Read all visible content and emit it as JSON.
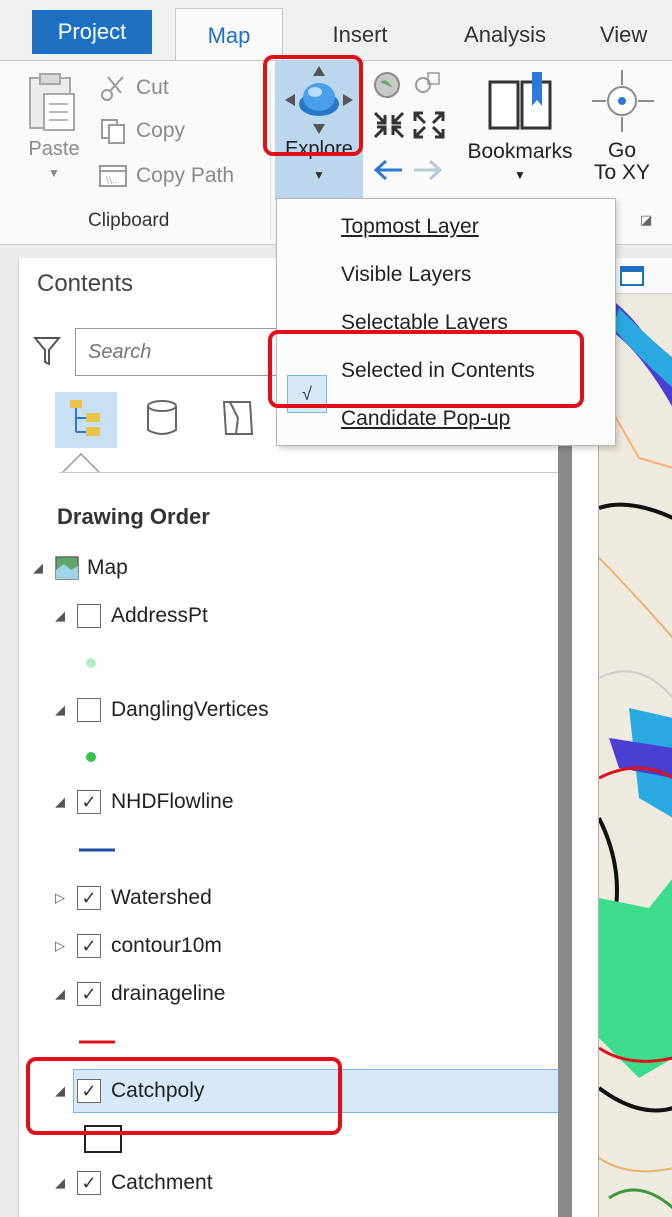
{
  "tabs": [
    {
      "label": "Project"
    },
    {
      "label": "Map"
    },
    {
      "label": "Insert"
    },
    {
      "label": "Analysis"
    },
    {
      "label": "View"
    }
  ],
  "clipboard": {
    "paste": "Paste",
    "cut": "Cut",
    "copy": "Copy",
    "copy_path": "Copy Path",
    "group_label": "Clipboard"
  },
  "navigate": {
    "explore": "Explore",
    "bookmarks": "Bookmarks",
    "goto_line1": "Go",
    "goto_line2": "To XY"
  },
  "explore_menu": {
    "items": [
      {
        "label": "Topmost Layer"
      },
      {
        "label": "Visible Layers"
      },
      {
        "label": "Selectable Layers"
      },
      {
        "label": "Selected in Contents"
      },
      {
        "label": "Candidate Pop-up"
      }
    ],
    "checked": "Selected in Contents",
    "check_glyph": "√"
  },
  "contents": {
    "title": "Contents",
    "search_placeholder": "Search",
    "section": "Drawing Order",
    "layers": [
      {
        "name": "Map",
        "expanded": true
      },
      {
        "name": "AddressPt",
        "checked": false,
        "expanded": true
      },
      {
        "name": "DanglingVertices",
        "checked": false,
        "expanded": true
      },
      {
        "name": "NHDFlowline",
        "checked": true,
        "expanded": true
      },
      {
        "name": "Watershed",
        "checked": true,
        "expanded": false
      },
      {
        "name": "contour10m",
        "checked": true,
        "expanded": false
      },
      {
        "name": "drainageline",
        "checked": true,
        "expanded": true
      },
      {
        "name": "Catchpoly",
        "checked": true,
        "expanded": true,
        "selected": true
      },
      {
        "name": "Catchment",
        "checked": true,
        "expanded": true
      }
    ]
  },
  "colors": {
    "project_tab": "#1d70c2",
    "selection": "#d7e8f6",
    "highlight": "#e0101a",
    "address_symbol": "#b8efc0",
    "dangling_symbol": "#33c24a",
    "flowline_symbol": "#1f4aa8",
    "drainage_symbol": "#e0101a"
  }
}
